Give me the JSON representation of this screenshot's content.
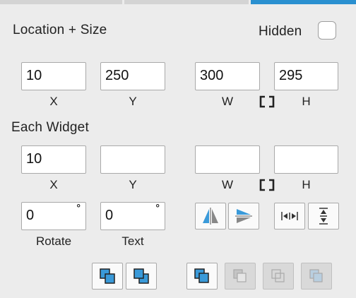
{
  "location_size": {
    "title": "Location + Size",
    "hidden_label": "Hidden",
    "hidden_checked": false,
    "x": "10",
    "y": "250",
    "w": "300",
    "h": "295",
    "x_label": "X",
    "y_label": "Y",
    "w_label": "W",
    "h_label": "H"
  },
  "each_widget": {
    "title": "Each Widget",
    "x": "10",
    "y": "",
    "w": "",
    "h": "",
    "x_label": "X",
    "y_label": "Y",
    "w_label": "W",
    "h_label": "H",
    "rotate": "0",
    "rotate_label": "Rotate",
    "text_rotate": "0",
    "text_label": "Text",
    "degree_symbol": "°"
  },
  "icons": {
    "link": "bracket-link-icon",
    "flip_horizontal": "flip-horizontal-icon",
    "flip_vertical": "flip-vertical-icon",
    "distribute_horizontal": "distribute-horizontal-icon",
    "distribute_vertical": "distribute-vertical-icon",
    "bring_forward": "bring-forward-icon",
    "send_backward": "send-backward-icon",
    "bring_to_front": "bring-to-front-icon",
    "send_to_back": "send-to-back-icon",
    "group": "group-icon",
    "ungroup": "ungroup-icon"
  },
  "colors": {
    "accent": "#2a90d0",
    "panel_bg": "#ececec",
    "layer_blue": "#3a9ad9"
  }
}
